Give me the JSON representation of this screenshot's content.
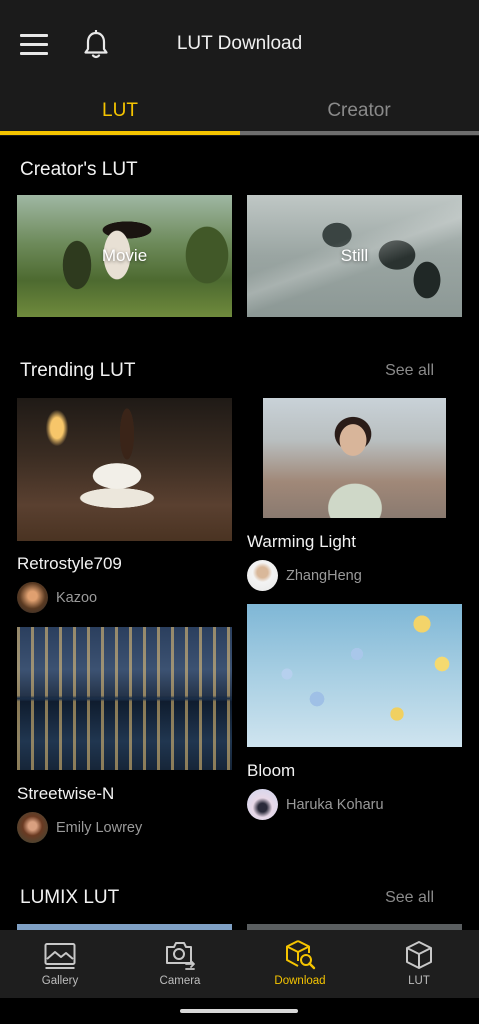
{
  "header": {
    "title": "LUT Download"
  },
  "tabs": [
    {
      "label": "LUT",
      "active": true
    },
    {
      "label": "Creator",
      "active": false
    }
  ],
  "creators_lut": {
    "title": "Creator's LUT",
    "cards": [
      {
        "label": "Movie"
      },
      {
        "label": "Still"
      }
    ]
  },
  "trending": {
    "title": "Trending LUT",
    "see_all": "See all",
    "items": [
      {
        "title": "Retrostyle709",
        "author": "Kazoo"
      },
      {
        "title": "Warming Light",
        "author": "ZhangHeng"
      },
      {
        "title": "Streetwise-N",
        "author": "Emily Lowrey"
      },
      {
        "title": "Bloom",
        "author": "Haruka Koharu"
      }
    ]
  },
  "lumix": {
    "title": "LUMIX LUT",
    "see_all": "See all"
  },
  "nav": [
    {
      "label": "Gallery",
      "icon": "gallery-icon",
      "active": false
    },
    {
      "label": "Camera",
      "icon": "camera-icon",
      "active": false
    },
    {
      "label": "Download",
      "icon": "download-icon",
      "active": true
    },
    {
      "label": "LUT",
      "icon": "lut-cube-icon",
      "active": false
    }
  ],
  "colors": {
    "accent": "#f5c400",
    "background": "#000000",
    "bar": "#1b1b1b",
    "muted": "#8a8a8a"
  }
}
